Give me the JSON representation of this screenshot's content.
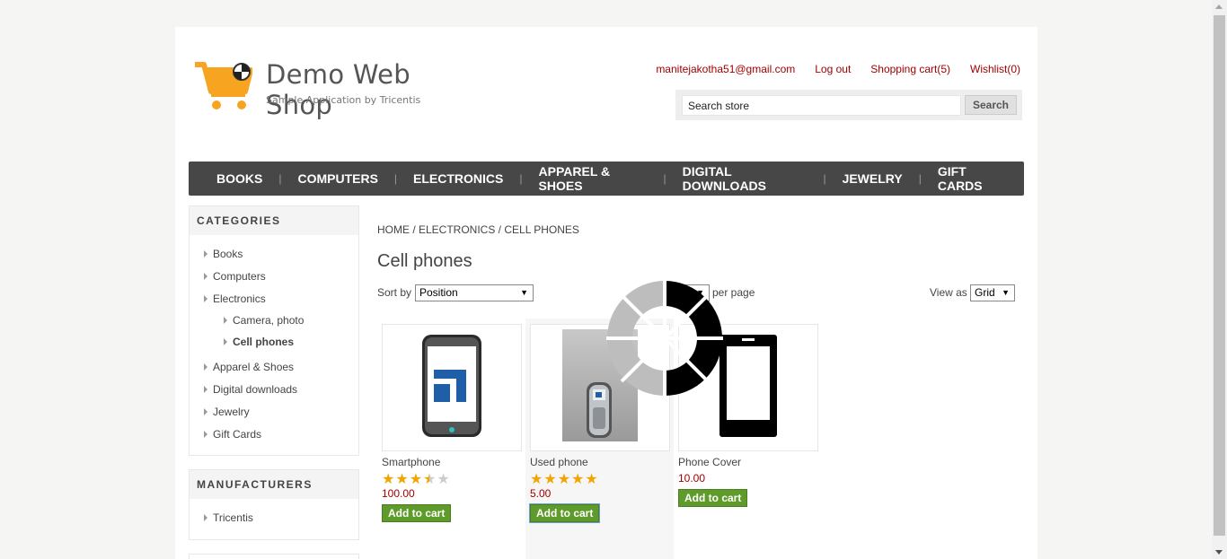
{
  "header": {
    "logo_title": "Demo Web Shop",
    "logo_subtitle": "Sample Application by Tricentis",
    "links": {
      "account": "manitejakotha51@gmail.com",
      "logout": "Log out",
      "cart": "Shopping cart(5)",
      "wishlist": "Wishlist(0)"
    },
    "search": {
      "value": "Search store",
      "button": "Search"
    }
  },
  "top_menu": [
    "BOOKS",
    "COMPUTERS",
    "ELECTRONICS",
    "APPAREL & SHOES",
    "DIGITAL DOWNLOADS",
    "JEWELRY",
    "GIFT CARDS"
  ],
  "categories": {
    "title": "CATEGORIES",
    "items": [
      "Books",
      "Computers",
      "Electronics",
      "Camera, photo",
      "Cell phones",
      "Apparel & Shoes",
      "Digital downloads",
      "Jewelry",
      "Gift Cards"
    ]
  },
  "manufacturers": {
    "title": "MANUFACTURERS",
    "items": [
      "Tricentis"
    ]
  },
  "breadcrumb": "HOME / ELECTRONICS / CELL PHONES",
  "page_title": "Cell phones",
  "sort": {
    "label": "Sort by",
    "value": "Position"
  },
  "page_size": {
    "label_fragment": "a",
    "label": "per page"
  },
  "view_as": {
    "label": "View as",
    "value": "Grid"
  },
  "products": [
    {
      "name": "Smartphone",
      "rating": 3.5,
      "price": "100.00",
      "button": "Add to cart"
    },
    {
      "name": "Used phone",
      "rating": 5,
      "price": "5.00",
      "button": "Add to cart"
    },
    {
      "name": "Phone Cover",
      "rating": null,
      "price": "10.00",
      "button": "Add to cart"
    }
  ],
  "colors": {
    "accent": "#a10000",
    "menu_bg": "#474747",
    "button_green": "#5e9b2a",
    "star": "#f0a500",
    "logo_orange": "#f7a421"
  }
}
